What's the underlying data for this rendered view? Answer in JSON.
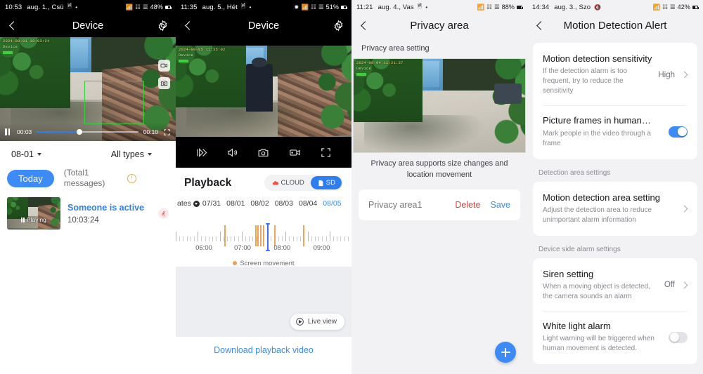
{
  "panel1": {
    "status": {
      "time": "10:53",
      "date": "aug. 1., Csü",
      "battery": "48%",
      "icons": [
        "image-icon",
        "dot-icon",
        "wifi-icon",
        "vpn-icon",
        "signal-icon"
      ]
    },
    "appbar": {
      "title": "Device",
      "back": "back-icon",
      "settings": "gear-icon"
    },
    "video": {
      "osd_time": "2024-08-01  10:03:24",
      "osd_device": "Device",
      "current": "00:03",
      "duration": "00:10",
      "progress_pct": 42
    },
    "filters": {
      "date": "08-01",
      "type": "All types"
    },
    "today_chip": "Today",
    "totals": "(Total1 messages)",
    "message": {
      "title": "Someone is active",
      "time": "10:03:24",
      "thumb_label": "Playing",
      "badge": "running-person-icon"
    }
  },
  "panel2": {
    "status": {
      "time": "11:35",
      "date": "aug. 5., Hét",
      "battery": "51%"
    },
    "appbar": {
      "title": "Device"
    },
    "video": {
      "osd_time": "2024-08-05  11:35:02",
      "osd_device": "Device"
    },
    "controls": [
      "speed-icon",
      "volume-icon",
      "camera-icon",
      "record-icon",
      "fullscreen-icon"
    ],
    "playback": {
      "title": "Playback",
      "cloud_label": "CLOUD",
      "sd_label": "SD",
      "dates_label": "ates",
      "dates": [
        "07/31",
        "08/01",
        "08/02",
        "08/03",
        "08/04",
        "08/05"
      ],
      "selected_date": "08/05",
      "timeline_labels": [
        "06:00",
        "07:00",
        "08:00",
        "09:00"
      ],
      "legend": "Screen movement",
      "live_view": "Live view",
      "download": "Download playback video"
    }
  },
  "panel3": {
    "status": {
      "time": "11:21",
      "date": "aug. 4., Vas",
      "battery": "88%"
    },
    "appbar": {
      "title": "Privacy area"
    },
    "subtitle": "Privacy area setting",
    "video": {
      "osd_time": "2024-08-04  11:21:37",
      "osd_device": "Device"
    },
    "hint": "Privacy area supports size changes and location movement",
    "area_row": {
      "name": "Privacy area1",
      "delete": "Delete",
      "save": "Save"
    },
    "fab": "add-icon"
  },
  "panel4": {
    "status": {
      "time": "14:34",
      "date": "aug. 3., Szo",
      "battery": "42%"
    },
    "appbar": {
      "title": "Motion Detection Alert"
    },
    "rows": [
      {
        "title": "Motion detection sensitivity",
        "desc": "If the detection alarm is too frequent, try to reduce the sensitivity",
        "value": "High",
        "control": "chevron"
      },
      {
        "title": "Picture frames in human…",
        "desc": "Mark people in the video through a frame",
        "value": "",
        "control": "toggle-on"
      }
    ],
    "section2_label": "Detection area settings",
    "rows2": [
      {
        "title": "Motion detection area setting",
        "desc": "Adjust the detection area to reduce unimportant alarm information",
        "value": "",
        "control": "chevron"
      }
    ],
    "section3_label": "Device side alarm settings",
    "rows3": [
      {
        "title": "Siren setting",
        "desc": "When a moving object is detected, the camera sounds an alarm",
        "value": "Off",
        "control": "chevron"
      },
      {
        "title": "White light alarm",
        "desc": "Light warning will be triggered when human movement is detected.",
        "value": "",
        "control": "toggle-off"
      }
    ]
  },
  "colors": {
    "accent": "#3d8bf8",
    "danger": "#e0443e",
    "event": "#f0a259",
    "cursor": "#3d6ef8"
  }
}
